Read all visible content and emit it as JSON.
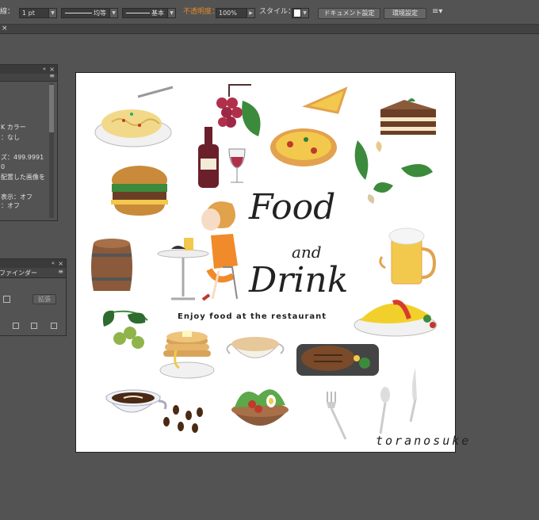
{
  "control_bar": {
    "stroke_label": "線：",
    "stroke_weight": "1 pt",
    "profile_value": "均等",
    "brush_value": "基本",
    "opacity_label": "不透明度：",
    "opacity_value": "100%",
    "style_label": "スタイル：",
    "document_setup_label": "ドキュメント設定",
    "preferences_label": "環境設定",
    "colors": {
      "opacity_label": "#e08a2a",
      "bg": "#535353"
    }
  },
  "info_panel": {
    "lines": [
      "K カラー",
      "：なし",
      "ズ：499.9991",
      "0",
      "配置した画像を",
      "表示：オフ",
      "：オフ"
    ]
  },
  "pathfinder_panel": {
    "title": "ファインダー",
    "expand_label": "拡張"
  },
  "artwork": {
    "title_line1": "Food",
    "title_line2": "and",
    "title_line3": "Drink",
    "tagline": "Enjoy food at the restaurant",
    "signature": "toranosuke"
  }
}
